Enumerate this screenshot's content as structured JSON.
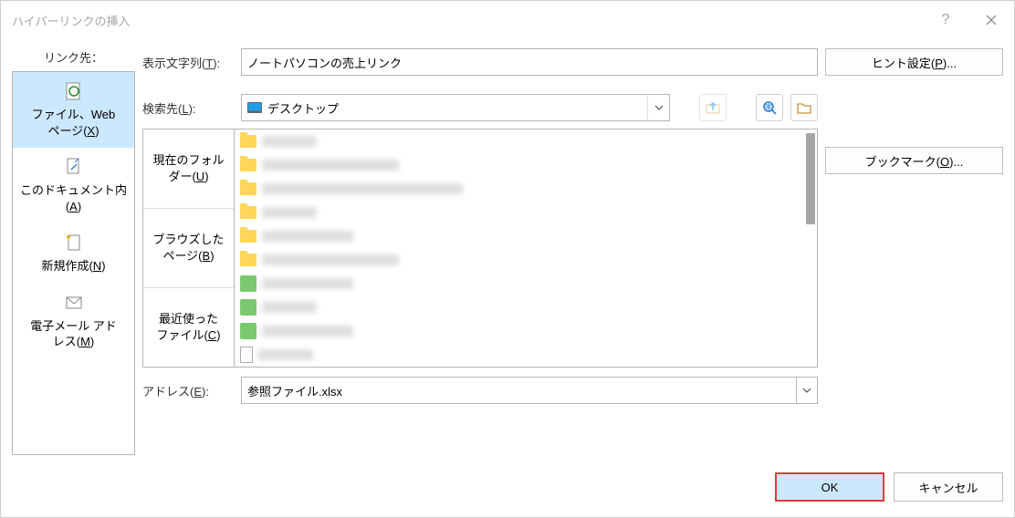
{
  "dialog": {
    "title": "ハイパーリンクの挿入",
    "close_label": "×"
  },
  "link_to": {
    "label": "リンク先：",
    "tabs": {
      "file_web": {
        "line1": "ファイル、Web",
        "line2_pre": "ページ(",
        "line2_key": "X",
        "line2_post": ")"
      },
      "this_doc": {
        "line1": "このドキュメント内",
        "line2_pre": "(",
        "line2_key": "A",
        "line2_post": ")"
      },
      "new_doc": {
        "line1_pre": "新規作成(",
        "line1_key": "N",
        "line1_post": ")"
      },
      "email": {
        "line1": "電子メール アド",
        "line2_pre": "レス(",
        "line2_key": "M",
        "line2_post": ")"
      }
    }
  },
  "display_text": {
    "label_pre": "表示文字列(",
    "label_key": "T",
    "label_post": "): ",
    "value": "ノートパソコンの売上リンク"
  },
  "look_in": {
    "label_pre": "検索先(",
    "label_key": "L",
    "label_post": "): ",
    "value": "デスクトップ"
  },
  "browse_tabs": {
    "current": {
      "line1": "現在のフォル",
      "line2_pre": "ダー(",
      "line2_key": "U",
      "line2_post": ")"
    },
    "browsed": {
      "line1": "ブラウズした",
      "line2_pre": "ページ(",
      "line2_key": "B",
      "line2_post": ")"
    },
    "recent": {
      "line1": "最近使った",
      "line2_pre": "ファイル(",
      "line2_key": "C",
      "line2_post": ")"
    }
  },
  "address": {
    "label_pre": "アドレス(",
    "label_key": "E",
    "label_post": "): ",
    "value": "参照ファイル.xlsx"
  },
  "right": {
    "screentip_pre": "ヒント設定(",
    "screentip_key": "P",
    "screentip_post": ")...",
    "bookmark_pre": "ブックマーク(",
    "bookmark_key": "O",
    "bookmark_post": ")..."
  },
  "footer": {
    "ok": "OK",
    "cancel": "キャンセル"
  }
}
